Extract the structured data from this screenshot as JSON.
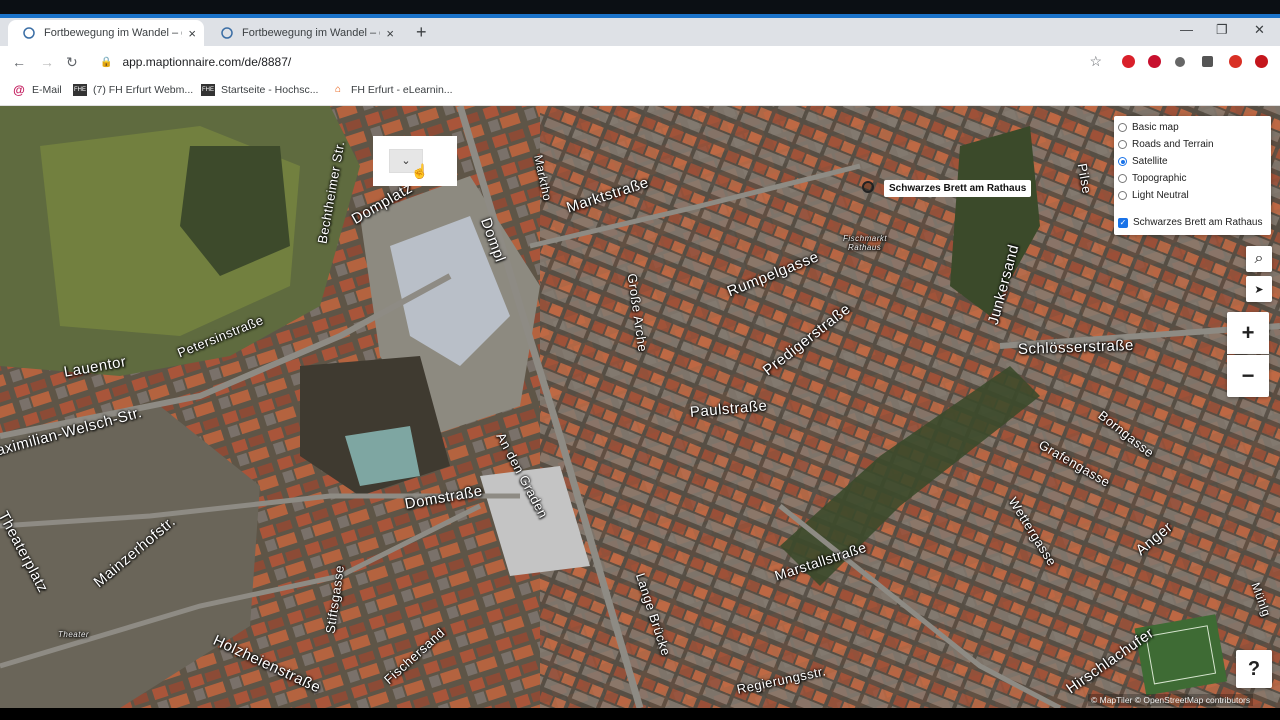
{
  "browser": {
    "tabs": [
      {
        "title": "Fortbewegung im Wandel – gesu",
        "active": true
      },
      {
        "title": "Fortbewegung im Wandel – gesu",
        "active": false
      }
    ],
    "new_tab": "+",
    "close_glyph": "×",
    "window_controls": {
      "minimize": "—",
      "restore": "❐",
      "close": "✕"
    },
    "nav": {
      "back": "←",
      "forward": "→",
      "reload": "↻"
    },
    "url": "app.maptionnaire.com/de/8887/",
    "lock_icon": "🔒",
    "star_icon": "☆"
  },
  "bookmarks": [
    {
      "label": "E-Mail",
      "icon": "@"
    },
    {
      "label": "(7) FH Erfurt Webm...",
      "icon": "FHE"
    },
    {
      "label": "Startseite - Hochsc...",
      "icon": "FHE"
    },
    {
      "label": "FH Erfurt - eLearnin...",
      "icon": "⌂"
    }
  ],
  "map": {
    "layer_options": [
      {
        "label": "Basic map",
        "selected": false
      },
      {
        "label": "Roads and Terrain",
        "selected": false
      },
      {
        "label": "Satellite",
        "selected": true
      },
      {
        "label": "Topographic",
        "selected": false
      },
      {
        "label": "Light Neutral",
        "selected": false
      }
    ],
    "overlay": {
      "label": "Schwarzes Brett am Rathaus",
      "checked": true
    },
    "marker_label": "Schwarzes Brett am Rathaus",
    "controls": {
      "search": "⌕",
      "locate": "➤",
      "zoom_in": "+",
      "zoom_out": "−",
      "help": "?"
    },
    "dropdown_glyph": "⌄",
    "attribution": "© MapTiler © OpenStreetMap contributors",
    "street_labels": [
      "Marktstraße",
      "Domplatz",
      "Dompl",
      "Bechtheimer Str.",
      "Petersinstraße",
      "Lauentor",
      "Maximilian-Welsch-Str.",
      "Theaterplatz",
      "Mainzerhofstr.",
      "Holzheienstraße",
      "Stiftsgasse",
      "Fischersand",
      "Domstraße",
      "An den Graden",
      "Große Arche",
      "Rumpelgasse",
      "Predigerstraße",
      "Paulstraße",
      "Lange Brücke",
      "Marstallstraße",
      "Regierungsstr.",
      "Schlösserstraße",
      "Junkersand",
      "Borngasse",
      "Grafengasse",
      "Wettergasse",
      "Anger",
      "Hirschlachufer",
      "Marktho",
      "Fischmarkt",
      "Rathaus",
      "Theater",
      "Pilse",
      "Mühlg"
    ]
  }
}
